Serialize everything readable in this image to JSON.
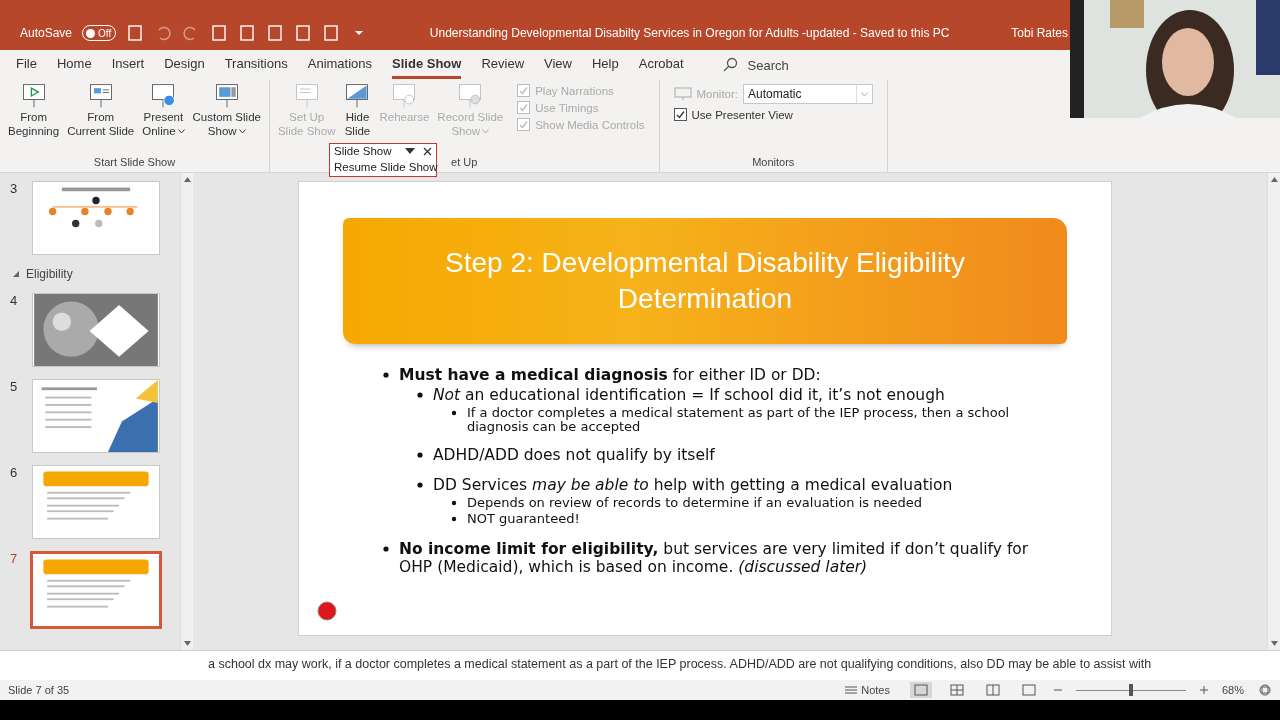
{
  "title_bar": {
    "autosave_label": "AutoSave",
    "autosave_toggle": {
      "label": "Off",
      "on": false
    },
    "title": "Understanding Developmental Disabilty Services in Oregon for Adults -updated  -  Saved to this PC",
    "user": "Tobi Rates"
  },
  "ribbon_tabs": [
    {
      "label": "File",
      "selected": false
    },
    {
      "label": "Home",
      "selected": false
    },
    {
      "label": "Insert",
      "selected": false
    },
    {
      "label": "Design",
      "selected": false
    },
    {
      "label": "Transitions",
      "selected": false
    },
    {
      "label": "Animations",
      "selected": false
    },
    {
      "label": "Slide Show",
      "selected": true
    },
    {
      "label": "Review",
      "selected": false
    },
    {
      "label": "View",
      "selected": false
    },
    {
      "label": "Help",
      "selected": false
    },
    {
      "label": "Acrobat",
      "selected": false
    }
  ],
  "search": {
    "placeholder": "Search"
  },
  "ribbon_groups": [
    {
      "label": "Start Slide Show",
      "buttons": [
        {
          "kind": "play",
          "lines": [
            "From",
            "Beginning"
          ],
          "disabled": false,
          "dropdown": false
        },
        {
          "kind": "current",
          "lines": [
            "From",
            "Current Slide"
          ],
          "disabled": false,
          "dropdown": false
        },
        {
          "kind": "online",
          "lines": [
            "Present",
            "Online"
          ],
          "disabled": false,
          "dropdown": true
        },
        {
          "kind": "custom",
          "lines": [
            "Custom Slide",
            "Show"
          ],
          "disabled": false,
          "dropdown": true
        }
      ]
    },
    {
      "label": "et Up",
      "buttons": [
        {
          "kind": "setup",
          "lines": [
            "Set Up",
            "Slide Show"
          ],
          "disabled": true,
          "dropdown": false
        },
        {
          "kind": "hide",
          "lines": [
            "Hide",
            "Slide"
          ],
          "disabled": false,
          "dropdown": false
        },
        {
          "kind": "rehearse",
          "lines": [
            "Rehearse"
          ],
          "disabled": true,
          "dropdown": false
        },
        {
          "kind": "record",
          "lines": [
            "Record Slide",
            "Show"
          ],
          "disabled": true,
          "dropdown": true
        }
      ],
      "checkboxes": [
        {
          "label": "Play Narrations",
          "checked": true,
          "disabled": true
        },
        {
          "label": "Use Timings",
          "checked": true,
          "disabled": true
        },
        {
          "label": "Show Media Controls",
          "checked": true,
          "disabled": true
        }
      ]
    },
    {
      "label": "Monitors",
      "monitor": {
        "label": "Monitor:",
        "value": "Automatic",
        "disabled": true
      },
      "checkboxes": [
        {
          "label": "Use Presenter View",
          "checked": true,
          "disabled": false
        }
      ]
    }
  ],
  "popup": {
    "title": "Slide Show",
    "link": "Resume Slide Show"
  },
  "slide_panel": [
    {
      "kind": "slide",
      "number": "3",
      "selected": false
    },
    {
      "kind": "section",
      "title": "Eligibility",
      "expanded": true
    },
    {
      "kind": "slide",
      "number": "4",
      "selected": false
    },
    {
      "kind": "slide",
      "number": "5",
      "selected": false
    },
    {
      "kind": "slide",
      "number": "6",
      "selected": false
    },
    {
      "kind": "slide",
      "number": "7",
      "selected": true
    }
  ],
  "slide": {
    "title": "Step 2: Developmental Disability Eligibility Determination",
    "bullets": [
      {
        "text": "**Must have a medical diagnosis** for either ID or DD:",
        "children": [
          {
            "text": "*Not* an educational identification = If school did it, it’s not enough",
            "children": [
              {
                "text": "If a doctor completes a medical statement as part of the IEP process, then a school diagnosis can be accepted"
              }
            ]
          },
          {
            "text": "ADHD/ADD does not qualify by itself"
          },
          {
            "text": "DD Services *may be able to* help with getting a medical evaluation",
            "children": [
              {
                "text": "Depends on review of records to determine if an evaluation is needed"
              },
              {
                "text": "NOT guaranteed!"
              }
            ]
          }
        ]
      },
      {
        "text": "**No income limit for eligibility,** but services are very limited if don’t qualify for OHP (Medicaid), which is based on income. *(discussed later)*"
      }
    ]
  },
  "notes": "a school dx may work, if a doctor completes a medical statement as a part of the IEP process. ADHD/ADD are not qualifying conditions, also DD may be able to assist with",
  "status_bar": {
    "slide_info": "Slide 7 of 35",
    "notes_button": "Notes",
    "zoom": {
      "level": 0.5
    },
    "zoom_text": "68%"
  }
}
